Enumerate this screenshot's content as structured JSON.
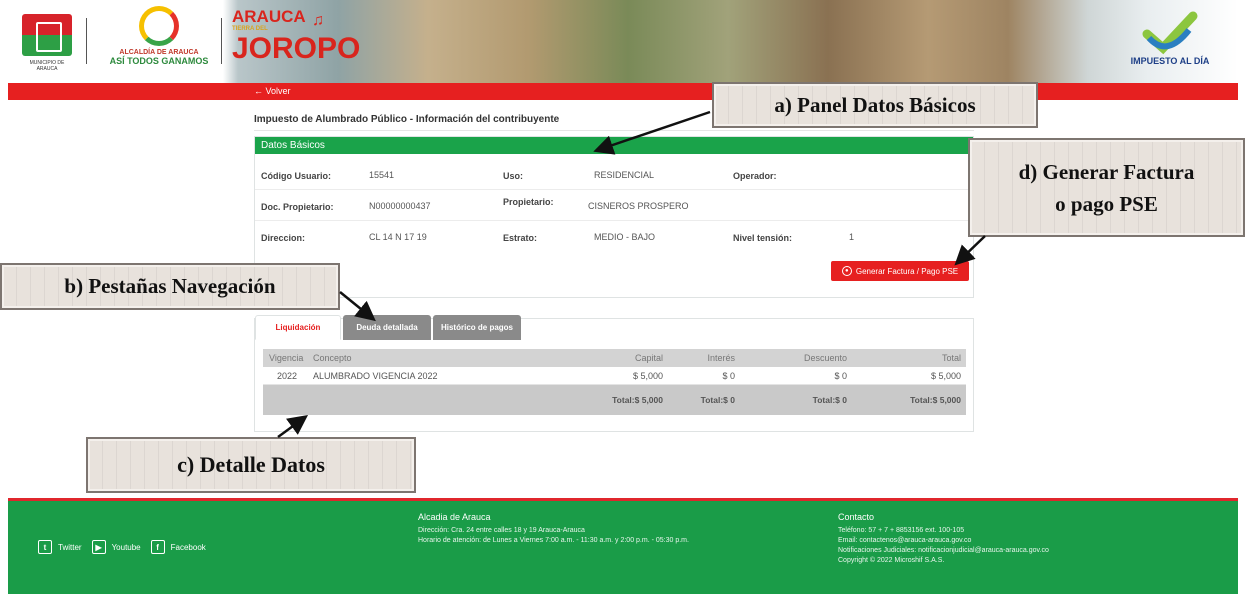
{
  "header": {
    "municipio_caption": "MUNICIPIO DE ARAUCA",
    "alcaldia_line1": "ALCALDÍA DE ARAUCA",
    "alcaldia_line2": "ASÍ TODOS GANAMOS",
    "arauca_top": "ARAUCA",
    "arauca_mid": "TIERRA DEL",
    "arauca_big": "JOROPO",
    "impuesto_logo": "IMPUESTO AL DÍA"
  },
  "nav": {
    "back_label": "← Volver"
  },
  "page": {
    "title": "Impuesto de Alumbrado Público - Información del contribuyente"
  },
  "panel": {
    "heading": "Datos Básicos",
    "fields": {
      "codigo_usuario": {
        "label": "Código Usuario:",
        "value": "15541"
      },
      "uso": {
        "label": "Uso:",
        "value": "RESIDENCIAL"
      },
      "operador": {
        "label": "Operador:",
        "value": ""
      },
      "doc_propietario": {
        "label": "Doc. Propietario:",
        "value": "N00000000437"
      },
      "propietario": {
        "label": "Propietario:",
        "value": "CISNEROS  PROSPERO"
      },
      "direccion": {
        "label": "Direccion:",
        "value": "CL  14  N  17  19"
      },
      "estrato": {
        "label": "Estrato:",
        "value": "MEDIO - BAJO"
      },
      "nivel_tension": {
        "label": "Nivel tensión:",
        "value": "1"
      }
    },
    "pse_button": "Generar Factura / Pago PSE"
  },
  "tabs": [
    {
      "label": "Liquidación",
      "active": true
    },
    {
      "label": "Deuda detallada",
      "active": false
    },
    {
      "label": "Histórico de pagos",
      "active": false
    }
  ],
  "table": {
    "columns": [
      "Vigencia",
      "Concepto",
      "Capital",
      "Interés",
      "Descuento",
      "Total"
    ],
    "rows": [
      {
        "vigencia": "2022",
        "concepto": "ALUMBRADO VIGENCIA 2022",
        "capital": "$ 5,000",
        "interes": "$ 0",
        "descuento": "$ 0",
        "total": "$ 5,000"
      }
    ],
    "totals": {
      "capital": "Total:$ 5,000",
      "interes": "Total:$ 0",
      "descuento": "Total:$ 0",
      "total": "Total:$ 5,000"
    }
  },
  "footer": {
    "social": {
      "twitter": "Twitter",
      "youtube": "Youtube",
      "facebook": "Facebook"
    },
    "org": {
      "heading": "Alcadia de Arauca",
      "address": "Dirección: Cra. 24 entre calles 18 y 19 Arauca-Arauca",
      "hours": "Horario de atención: de Lunes a Viernes 7:00 a.m. - 11:30 a.m. y 2:00 p.m. - 05:30 p.m."
    },
    "contact": {
      "heading": "Contacto",
      "phone": "Teléfono: 57 + 7 + 8853156 ext. 100-105",
      "email": "Email: contactenos@arauca-arauca.gov.co",
      "judicial": "Notificaciones Judiciales: notificacionjudicial@arauca-arauca.gov.co",
      "copyright": "Copyright © 2022 Microshif S.A.S."
    }
  },
  "annotations": {
    "a": "a) Panel Datos Básicos",
    "b": "b) Pestañas Navegación",
    "c": "c) Detalle Datos",
    "d_line1": "d) Generar Factura",
    "d_line2": "o pago PSE"
  },
  "colors": {
    "brand_green": "#1aa34a",
    "brand_red": "#e62020",
    "tab_inactive": "#8a8a8a"
  }
}
